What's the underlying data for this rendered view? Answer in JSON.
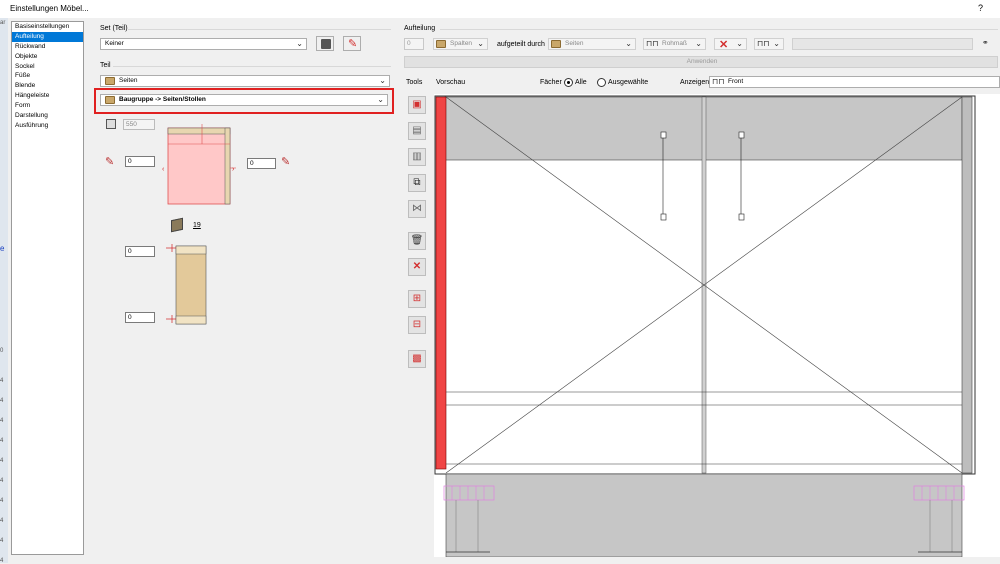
{
  "window": {
    "title": "Einstellungen Möbel...",
    "help": "?"
  },
  "left_strip": [
    "ar",
    "e",
    "0",
    "4",
    "4",
    "4",
    "4",
    "4",
    "4",
    "4",
    "4",
    "4",
    "4",
    "4",
    "4"
  ],
  "nav": {
    "items": [
      "Basiseinstellungen",
      "Aufteilung",
      "Rückwand",
      "Objekte",
      "Sockel",
      "Füße",
      "Blende",
      "Hängeleiste",
      "Form",
      "Darstellung",
      "Ausführung"
    ],
    "selected": "Aufteilung"
  },
  "set": {
    "label": "Set (Teil)",
    "value": "Keiner"
  },
  "teil": {
    "label": "Teil",
    "type_value": "Seiten",
    "group_value": "Baugruppe -> Seiten/Stollen",
    "highlight_color": "#e02020",
    "width_value": "550",
    "left_offset": "0",
    "right_offset": "0",
    "thickness": "19",
    "top_offset": "0",
    "bottom_offset": "0"
  },
  "aufteilung": {
    "label": "Aufteilung",
    "count": "0",
    "spalten": "Spalten",
    "aufgeteilt_durch_label": "aufgeteilt durch",
    "seiten": "Seiten",
    "rohmass": "Rohmaß",
    "anwenden": "Anwenden"
  },
  "tools": {
    "label": "Tools"
  },
  "preview": {
    "label": "Vorschau",
    "faecher_label": "Fächer",
    "radio_alle": "Alle",
    "radio_ausgewaehlte": "Ausgewählte",
    "radio_selected": "Alle",
    "anzeigen_label": "Anzeigen",
    "anzeigen_value": "Front"
  },
  "colors": {
    "selection": "#0078d7",
    "side_red": "#f04545",
    "panel_gray": "#c6c6c6",
    "pink_fill": "#ffc8c8"
  }
}
